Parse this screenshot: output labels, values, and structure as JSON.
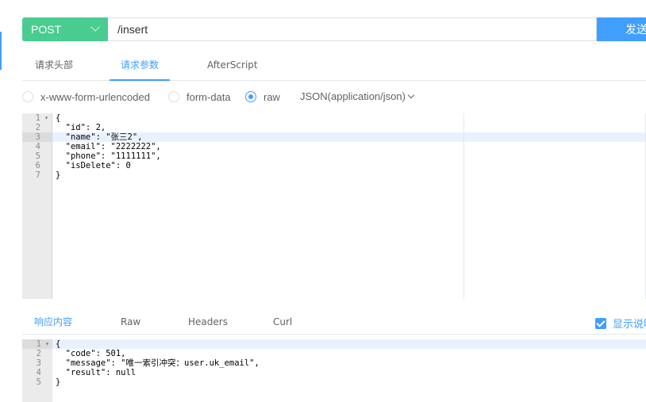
{
  "request": {
    "method": "POST",
    "url": "/insert",
    "send_label": "发送"
  },
  "request_tabs": [
    {
      "label": "请求头部",
      "active": false
    },
    {
      "label": "请求参数",
      "active": true
    },
    {
      "label": "AfterScript",
      "active": false
    }
  ],
  "body_types": [
    {
      "label": "x-www-form-urlencoded",
      "checked": false
    },
    {
      "label": "form-data",
      "checked": false
    },
    {
      "label": "raw",
      "checked": true
    }
  ],
  "content_type": "JSON(application/json)",
  "request_body": {
    "line_numbers": [
      "1",
      "2",
      "3",
      "4",
      "5",
      "6",
      "7"
    ],
    "active_line": 3,
    "lines": [
      "{",
      "  \"id\": 2,",
      "  \"name\": \"张三2\",",
      "  \"email\": \"2222222\",",
      "  \"phone\": \"1111111\",",
      "  \"isDelete\": 0",
      "}"
    ]
  },
  "response_tabs": [
    {
      "label": "响应内容",
      "active": true
    },
    {
      "label": "Raw",
      "active": false
    },
    {
      "label": "Headers",
      "active": false
    },
    {
      "label": "Curl",
      "active": false
    }
  ],
  "show_description": {
    "label": "显示说明",
    "checked": true
  },
  "response_body": {
    "line_numbers": [
      "1",
      "2",
      "3",
      "4",
      "5"
    ],
    "active_line": 1,
    "lines": [
      "{",
      "  \"code\": 501,",
      "  \"message\": \"唯一索引冲突：user.uk_email\",",
      "  \"result\": null",
      "}"
    ]
  },
  "colors": {
    "method_bg": "#49cc90",
    "primary": "#409eff",
    "gutter_bg": "#ebebeb"
  }
}
